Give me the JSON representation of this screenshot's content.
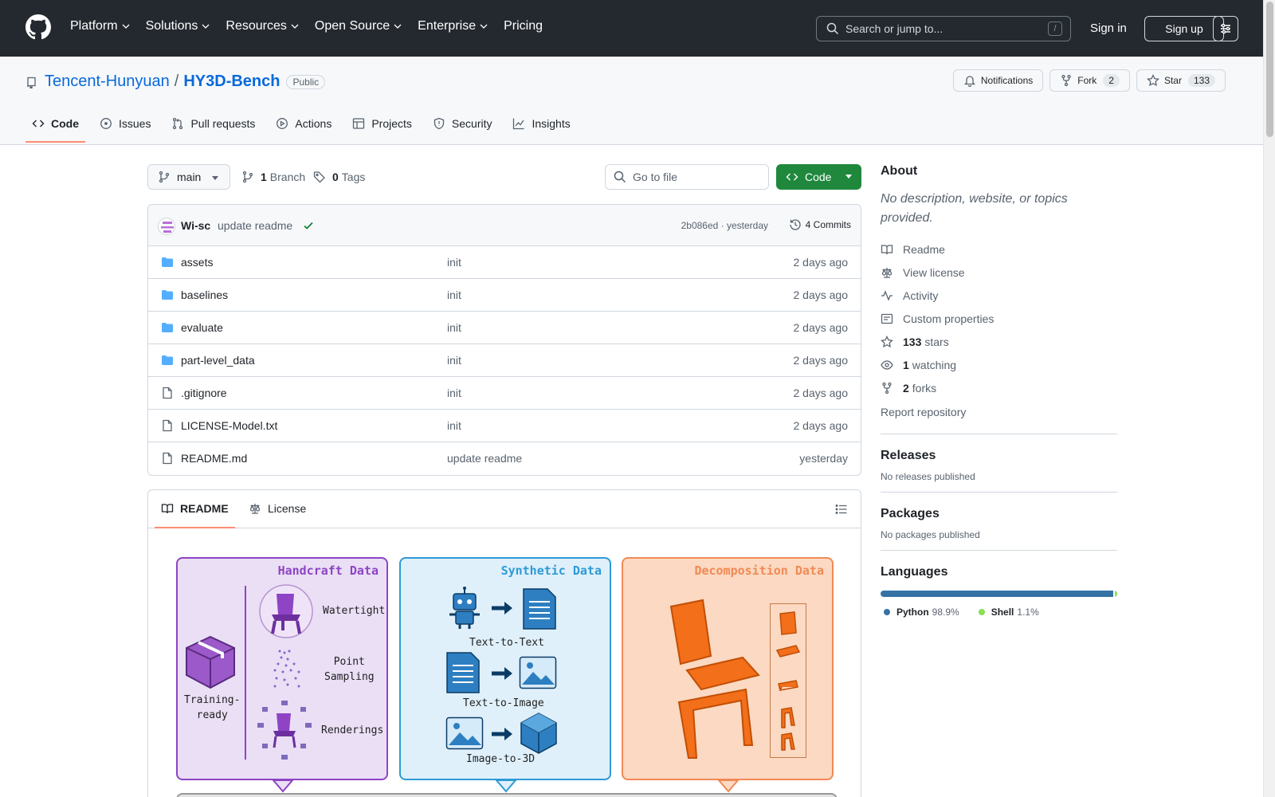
{
  "header": {
    "nav": [
      "Platform",
      "Solutions",
      "Resources",
      "Open Source",
      "Enterprise",
      "Pricing"
    ],
    "search_placeholder": "Search or jump to...",
    "search_shortcut": "/",
    "sign_in": "Sign in",
    "sign_up": "Sign up"
  },
  "repo": {
    "owner": "Tencent-Hunyuan",
    "separator": "/",
    "name": "HY3D-Bench",
    "visibility": "Public",
    "notifications_label": "Notifications",
    "fork_label": "Fork",
    "fork_count": "2",
    "star_label": "Star",
    "star_count": "133",
    "tabs": [
      "Code",
      "Issues",
      "Pull requests",
      "Actions",
      "Projects",
      "Security",
      "Insights"
    ],
    "active_tab": "Code"
  },
  "toolbar": {
    "branch": "main",
    "branch_count": "1",
    "branch_label": "Branch",
    "tag_count": "0",
    "tag_label": "Tags",
    "goto_placeholder": "Go to file",
    "code_button": "Code"
  },
  "commit": {
    "author": "Wi-sc",
    "message": "update readme",
    "meta": "2b086ed · yesterday",
    "count_label": "4 Commits"
  },
  "files": [
    {
      "name": "assets",
      "type": "dir",
      "message": "init",
      "date": "2 days ago"
    },
    {
      "name": "baselines",
      "type": "dir",
      "message": "init",
      "date": "2 days ago"
    },
    {
      "name": "evaluate",
      "type": "dir",
      "message": "init",
      "date": "2 days ago"
    },
    {
      "name": "part-level_data",
      "type": "dir",
      "message": "init",
      "date": "2 days ago"
    },
    {
      "name": ".gitignore",
      "type": "file",
      "message": "init",
      "date": "2 days ago"
    },
    {
      "name": "LICENSE-Model.txt",
      "type": "file",
      "message": "init",
      "date": "2 days ago"
    },
    {
      "name": "README.md",
      "type": "file",
      "message": "update readme",
      "date": "yesterday"
    }
  ],
  "readme": {
    "tab_readme": "README",
    "tab_license": "License",
    "figure": {
      "panel1_title": "Handcraft Data",
      "panel2_title": "Synthetic Data",
      "panel3_title": "Decomposition Data",
      "watertight": "Watertight",
      "point_sampling_1": "Point",
      "point_sampling_2": "Sampling",
      "renderings": "Renderings",
      "training_ready_1": "Training-",
      "training_ready_2": "ready",
      "text_to_text": "Text-to-Text",
      "text_to_image": "Text-to-Image",
      "image_to_3d": "Image-to-3D"
    }
  },
  "about": {
    "title": "About",
    "description": "No description, website, or topics provided.",
    "readme": "Readme",
    "license": "View license",
    "activity": "Activity",
    "custom_properties": "Custom properties",
    "stars_count": "133",
    "stars_label": "stars",
    "watching_count": "1",
    "watching_label": "watching",
    "forks_count": "2",
    "forks_label": "forks",
    "report": "Report repository"
  },
  "releases": {
    "title": "Releases",
    "note": "No releases published"
  },
  "packages": {
    "title": "Packages",
    "note": "No packages published"
  },
  "languages": {
    "title": "Languages",
    "items": [
      {
        "name": "Python",
        "percent": "98.9%",
        "value": 98.9,
        "color": "#3572A5"
      },
      {
        "name": "Shell",
        "percent": "1.1%",
        "value": 1.1,
        "color": "#89e051"
      }
    ]
  },
  "colors": {
    "accent": "#0969da",
    "green_button": "#1f883d",
    "header_bg": "#24292f",
    "tab_underline": "#fd8c73"
  }
}
